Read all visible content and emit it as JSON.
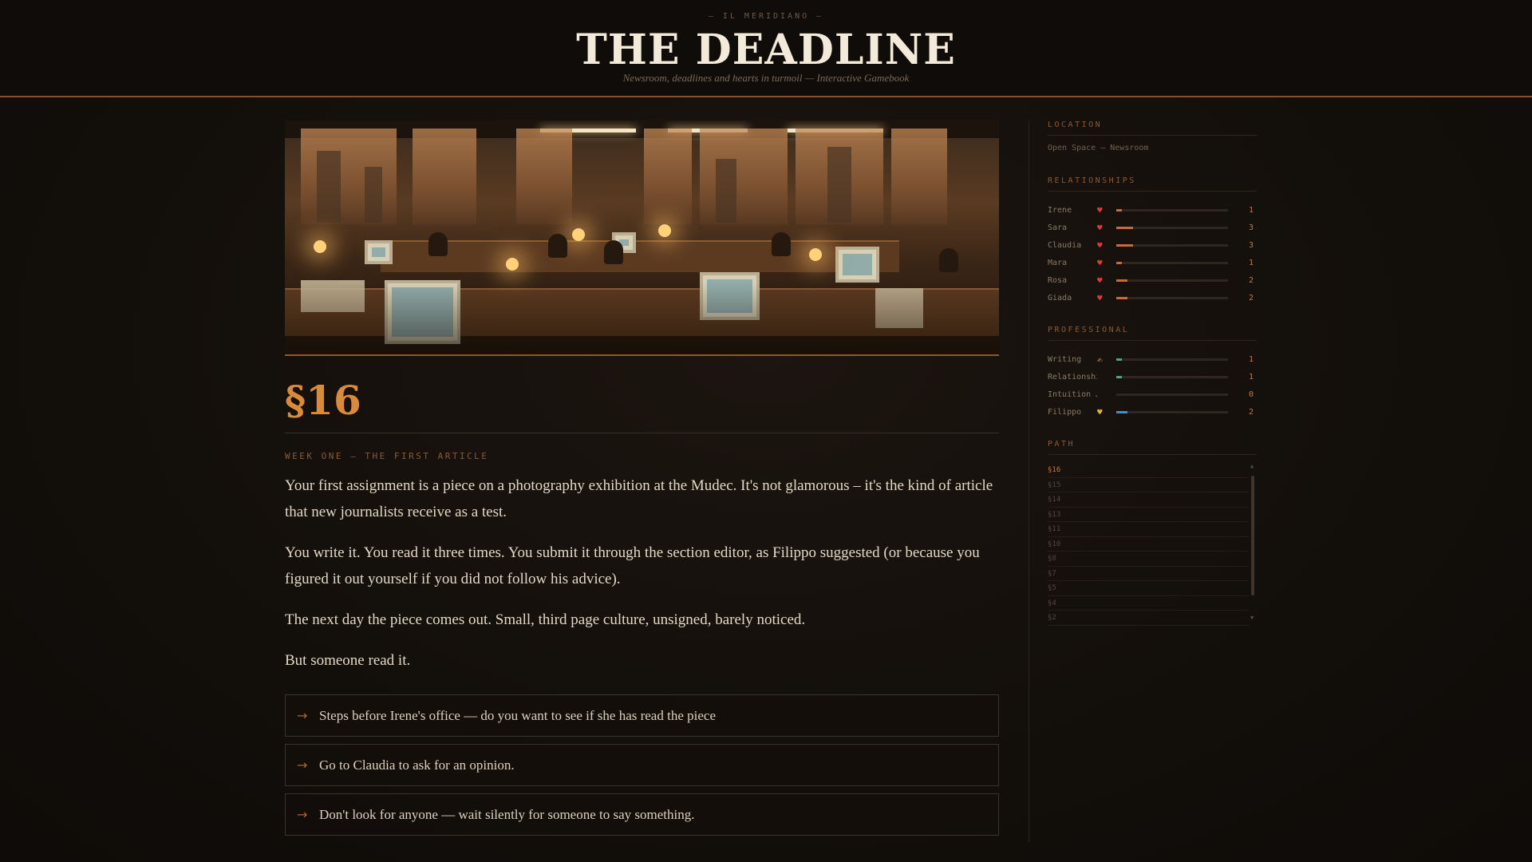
{
  "header": {
    "kicker": "— IL MERIDIANO —",
    "title": "THE DEADLINE",
    "tagline": "Newsroom, deadlines and hearts in turmoil — Interactive Gamebook"
  },
  "scene": {
    "section": "§16",
    "chapter": "WEEK ONE — THE FIRST ARTICLE",
    "paragraphs": [
      "Your first assignment is a piece on a photography exhibition at the Mudec. It's not glamorous – it's the kind of article that new journalists receive as a test.",
      "You write it. You read it three times. You submit it through the section editor, as Filippo suggested (or because you figured it out yourself if you did not follow his advice).",
      "The next day the piece comes out. Small, third page culture, unsigned, barely noticed.",
      "But someone read it."
    ],
    "choices": [
      {
        "arrow": "→",
        "text": "Steps before Irene's office — do you want to see if she has read the piece"
      },
      {
        "arrow": "→",
        "text": "Go to Claudia to ask for an opinion."
      },
      {
        "arrow": "→",
        "text": "Don't look for anyone — wait silently for someone to say something."
      }
    ]
  },
  "sidebar": {
    "location_head": "LOCATION",
    "location": "Open Space — Newsroom",
    "relationships_head": "RELATIONSHIPS",
    "relationships": [
      {
        "name": "Irene",
        "icon": "♥",
        "value": "1",
        "level": 0.05,
        "color": "#c86a3a"
      },
      {
        "name": "Sara",
        "icon": "♥",
        "value": "3",
        "level": 0.15,
        "color": "#c86a3a"
      },
      {
        "name": "Claudia",
        "icon": "♥",
        "value": "3",
        "level": 0.15,
        "color": "#c86a3a"
      },
      {
        "name": "Mara",
        "icon": "♥",
        "value": "1",
        "level": 0.05,
        "color": "#c86a3a"
      },
      {
        "name": "Rosa",
        "icon": "♥",
        "value": "2",
        "level": 0.1,
        "color": "#c86a3a"
      },
      {
        "name": "Giada",
        "icon": "♥",
        "value": "2",
        "level": 0.1,
        "color": "#c86a3a"
      }
    ],
    "professional_head": "PROFESSIONAL",
    "professional": [
      {
        "name": "Writing",
        "icon": "✍",
        "value": "1",
        "level": 0.05,
        "color": "#4aa58a"
      },
      {
        "name": "Relationshi…",
        "icon": "",
        "value": "1",
        "level": 0.05,
        "color": "#4aa58a"
      },
      {
        "name": "Intuition …",
        "icon": "",
        "value": "0",
        "level": 0.0,
        "color": "#4aa58a"
      },
      {
        "name": "Filippo",
        "icon": "♥",
        "value": "2",
        "level": 0.1,
        "color": "#4a8ac8"
      }
    ],
    "path_head": "PATH",
    "path": [
      "§16",
      "§15",
      "§14",
      "§13",
      "§11",
      "§10",
      "§8",
      "§7",
      "§5",
      "§4",
      "§2"
    ]
  },
  "colors": {
    "accent": "#d98a3a",
    "background": "#130f0b",
    "heart": "#d93a3a",
    "filippo_heart": "#e2b03a"
  }
}
